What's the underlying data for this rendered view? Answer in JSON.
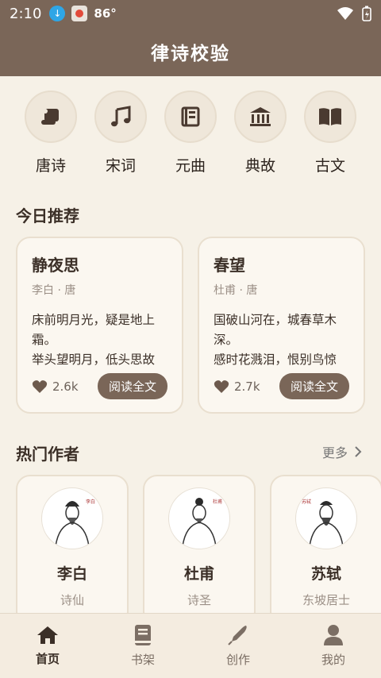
{
  "status_bar": {
    "time": "2:10",
    "temperature": "86°"
  },
  "header": {
    "title": "律诗校验"
  },
  "categories": [
    {
      "label": "唐诗",
      "icon": "scroll-icon"
    },
    {
      "label": "宋词",
      "icon": "music-note-icon"
    },
    {
      "label": "元曲",
      "icon": "book-outline-icon"
    },
    {
      "label": "典故",
      "icon": "temple-icon"
    },
    {
      "label": "古文",
      "icon": "open-book-icon"
    }
  ],
  "recommend": {
    "title": "今日推荐",
    "poems": [
      {
        "title": "静夜思",
        "author": "李白 · 唐",
        "text": "床前明月光，疑是地上霜。\n举头望明月，低头思故乡。",
        "likes": "2.6k",
        "button": "阅读全文"
      },
      {
        "title": "春望",
        "author": "杜甫 · 唐",
        "text": "国破山河在，城春草木深。\n感时花溅泪，恨别鸟惊心。",
        "likes": "2.7k",
        "button": "阅读全文"
      }
    ]
  },
  "authors_section": {
    "title": "热门作者",
    "more": "更多",
    "authors": [
      {
        "name": "李白",
        "title": "诗仙"
      },
      {
        "name": "杜甫",
        "title": "诗圣"
      },
      {
        "name": "苏轼",
        "title": "东坡居士"
      }
    ]
  },
  "tabbar": [
    {
      "label": "首页",
      "icon": "home-icon"
    },
    {
      "label": "书架",
      "icon": "book-icon"
    },
    {
      "label": "创作",
      "icon": "pen-icon"
    },
    {
      "label": "我的",
      "icon": "user-icon"
    }
  ],
  "colors": {
    "brand": "#7a6658",
    "background": "#f6f1e7"
  }
}
